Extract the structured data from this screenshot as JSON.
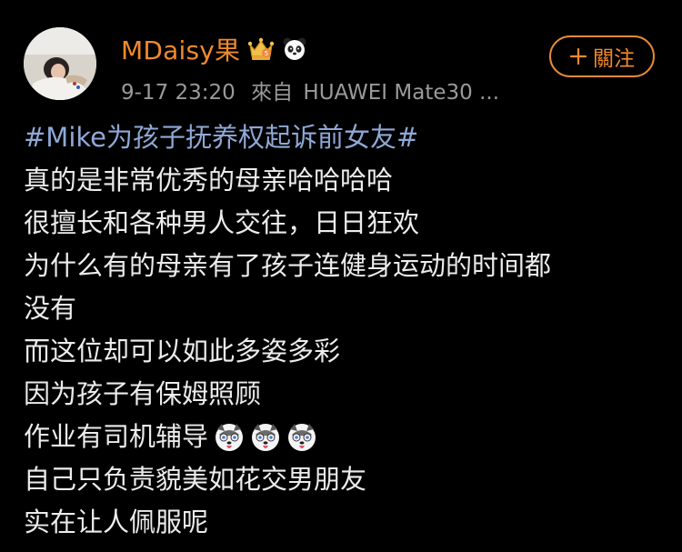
{
  "user": {
    "name": "MDaisy果",
    "badges": [
      "crown-badge-icon",
      "panda-icon"
    ]
  },
  "meta": {
    "time": "9-17 23:20",
    "source_prefix": "來自",
    "source": "HUAWEI Mate30 ..."
  },
  "follow_button": {
    "icon": "plus-icon",
    "label": "關注"
  },
  "post": {
    "hashtag": "#Mike为孩子抚养权起诉前女友#",
    "lines": [
      "真的是非常优秀的母亲哈哈哈哈",
      "很擅长和各种男人交往，日日狂欢",
      "为什么有的母亲有了孩子连健身运动的时间都",
      "没有",
      "而这位却可以如此多姿多彩",
      "因为孩子有保姆照顾",
      "作业有司机辅导",
      "自己只负责貌美如花交男朋友",
      "实在让人佩服呢"
    ],
    "emojis": [
      "husky-dog-emoji-icon",
      "husky-dog-emoji-icon",
      "husky-dog-emoji-icon"
    ]
  },
  "colors": {
    "background": "#000000",
    "username": "#f08a2e",
    "hashtag": "#8fa8d6",
    "meta": "#9a9a9a",
    "text": "#ececec"
  }
}
